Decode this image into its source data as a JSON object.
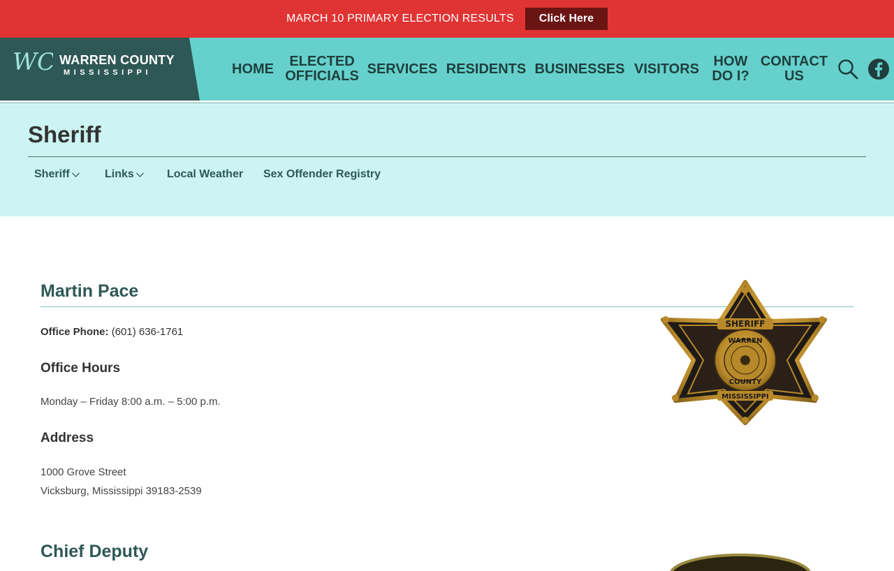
{
  "alert": {
    "text": "MARCH 10 PRIMARY ELECTION RESULTS",
    "button": "Click Here"
  },
  "logo": {
    "monogram": "WC",
    "name": "WARREN COUNTY",
    "sub": "MISSISSIPPI"
  },
  "nav": {
    "home": "HOME",
    "elected": "ELECTED\nOFFICIALS",
    "services": "SERVICES",
    "residents": "RESIDENTS",
    "businesses": "BUSINESSES",
    "visitors": "VISITORS",
    "howdoi": "HOW\nDO I?",
    "contact": "CONTACT\nUS"
  },
  "page": {
    "title": "Sheriff",
    "subnav": [
      "Sheriff",
      "Links",
      "Local Weather",
      "Sex Offender Registry"
    ]
  },
  "content": {
    "name": "Martin Pace",
    "phone_label": "Office Phone:",
    "phone": "(601) 636-1761",
    "hours_head": "Office Hours",
    "hours": "Monday – Friday 8:00 a.m. – 5:00 p.m.",
    "address_head": "Address",
    "address_line1": "1000 Grove Street",
    "address_line2": "Vicksburg, Mississippi 39183-2539",
    "second_head": "Chief Deputy"
  },
  "badge": {
    "top": "SHERIFF",
    "ring_top": "WARREN",
    "ring_bottom": "COUNTY",
    "bottom": "MISSISSIPPI"
  },
  "colors": {
    "alert": "#e03333",
    "alert_button": "#6b1414",
    "header": "#66d1cc",
    "logo_bg": "#2e5856",
    "band": "#cbf4f2",
    "heading": "#2e5856"
  }
}
